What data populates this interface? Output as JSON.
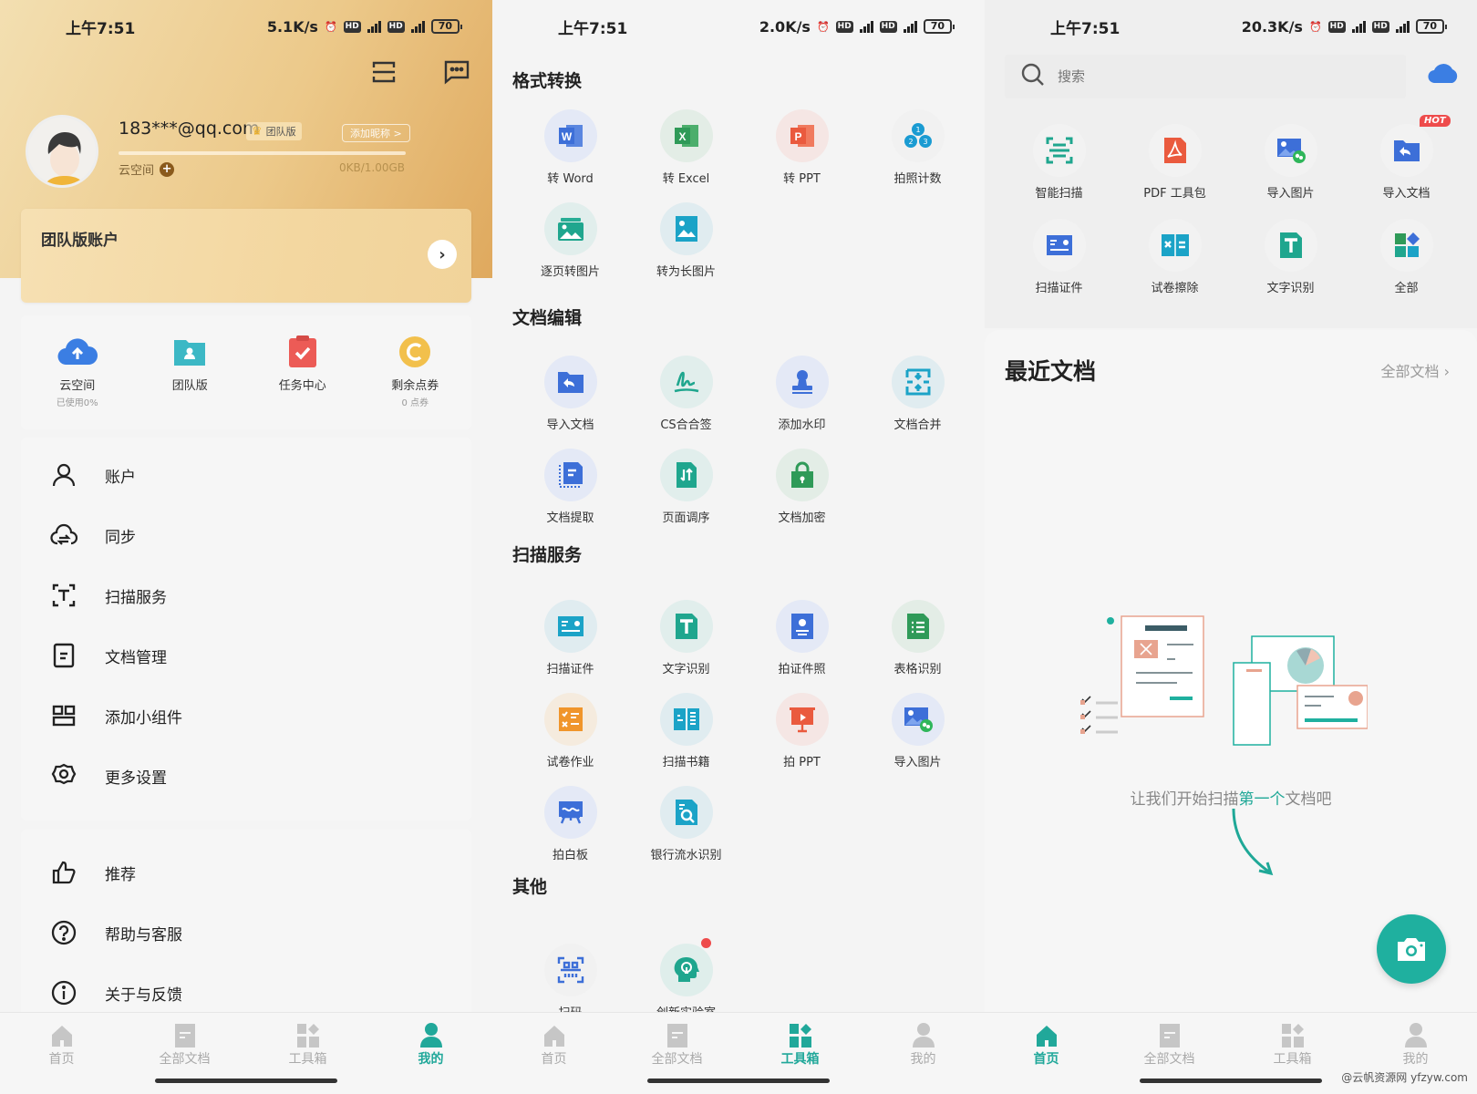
{
  "colors": {
    "accent": "#21a89a",
    "gold_start": "#f3dfb1",
    "gold_end": "#dfa95e",
    "badge_red": "#ee4b4b"
  },
  "status_bars": [
    {
      "time": "上午7:51",
      "speed": "5.1K/s",
      "battery": "70"
    },
    {
      "time": "上午7:51",
      "speed": "2.0K/s",
      "battery": "70"
    },
    {
      "time": "上午7:51",
      "speed": "20.3K/s",
      "battery": "70"
    }
  ],
  "profile": {
    "email": "183***@qq.com",
    "plan_badge": "团队版",
    "add_nickname": "添加昵称 >",
    "cloud_label": "云空间",
    "cloud_usage": "0KB/1.00GB",
    "cloud_used_fraction": 0.0,
    "team_card_title": "团队版账户",
    "icons": [
      "scan-icon",
      "message-icon"
    ]
  },
  "quick_actions": [
    {
      "label": "云空间",
      "sub": "已使用0%",
      "icon": "cloud-upload-icon"
    },
    {
      "label": "团队版",
      "sub": "",
      "icon": "team-folder-icon"
    },
    {
      "label": "任务中心",
      "sub": "",
      "icon": "task-check-icon"
    },
    {
      "label": "剩余点券",
      "sub": "0 点券",
      "icon": "coupon-coin-icon"
    }
  ],
  "menu_main": [
    {
      "label": "账户",
      "icon": "user-icon"
    },
    {
      "label": "同步",
      "icon": "cloud-sync-icon"
    },
    {
      "label": "扫描服务",
      "icon": "text-scan-icon"
    },
    {
      "label": "文档管理",
      "icon": "document-icon"
    },
    {
      "label": "添加小组件",
      "icon": "widget-icon"
    },
    {
      "label": "更多设置",
      "icon": "gear-icon"
    }
  ],
  "menu_secondary": [
    {
      "label": "推荐",
      "icon": "thumbs-up-icon"
    },
    {
      "label": "帮助与客服",
      "icon": "help-icon"
    },
    {
      "label": "关于与反馈",
      "icon": "info-icon"
    }
  ],
  "bottom_nav": [
    {
      "label": "首页",
      "icon": "home-icon"
    },
    {
      "label": "全部文档",
      "icon": "documents-icon"
    },
    {
      "label": "工具箱",
      "icon": "toolbox-icon"
    },
    {
      "label": "我的",
      "icon": "me-icon"
    }
  ],
  "toolbox": {
    "sections": [
      {
        "title": "格式转换",
        "items": [
          {
            "label": "转 Word",
            "icon": "word-icon"
          },
          {
            "label": "转 Excel",
            "icon": "excel-icon"
          },
          {
            "label": "转 PPT",
            "icon": "ppt-icon"
          },
          {
            "label": "拍照计数",
            "icon": "photo-count-icon"
          },
          {
            "label": "逐页转图片",
            "icon": "pages-to-image-icon"
          },
          {
            "label": "转为长图片",
            "icon": "long-image-icon"
          }
        ]
      },
      {
        "title": "文档编辑",
        "items": [
          {
            "label": "导入文档",
            "icon": "import-doc-icon"
          },
          {
            "label": "CS合合签",
            "icon": "signature-icon"
          },
          {
            "label": "添加水印",
            "icon": "watermark-stamp-icon"
          },
          {
            "label": "文档合并",
            "icon": "merge-icon"
          },
          {
            "label": "文档提取",
            "icon": "extract-icon"
          },
          {
            "label": "页面调序",
            "icon": "reorder-icon"
          },
          {
            "label": "文档加密",
            "icon": "lock-icon"
          }
        ]
      },
      {
        "title": "扫描服务",
        "items": [
          {
            "label": "扫描证件",
            "icon": "id-card-icon"
          },
          {
            "label": "文字识别",
            "icon": "ocr-text-icon"
          },
          {
            "label": "拍证件照",
            "icon": "id-photo-icon"
          },
          {
            "label": "表格识别",
            "icon": "table-ocr-icon"
          },
          {
            "label": "试卷作业",
            "icon": "exam-icon"
          },
          {
            "label": "扫描书籍",
            "icon": "book-scan-icon"
          },
          {
            "label": "拍 PPT",
            "icon": "presentation-icon"
          },
          {
            "label": "导入图片",
            "icon": "import-image-icon"
          },
          {
            "label": "拍白板",
            "icon": "whiteboard-icon"
          },
          {
            "label": "银行流水识别",
            "icon": "bank-statement-icon"
          }
        ]
      },
      {
        "title": "其他",
        "items": [
          {
            "label": "扫码",
            "icon": "qr-scan-icon"
          },
          {
            "label": "创新实验室",
            "icon": "innovation-lab-icon",
            "badge_dot": true
          }
        ]
      }
    ]
  },
  "home": {
    "search_placeholder": "搜索",
    "tools": [
      {
        "label": "智能扫描",
        "icon": "smart-scan-icon"
      },
      {
        "label": "PDF 工具包",
        "icon": "pdf-icon"
      },
      {
        "label": "导入图片",
        "icon": "import-image-icon"
      },
      {
        "label": "导入文档",
        "icon": "import-doc-icon",
        "badge": "HOT"
      },
      {
        "label": "扫描证件",
        "icon": "id-card-icon"
      },
      {
        "label": "试卷擦除",
        "icon": "exam-erase-icon"
      },
      {
        "label": "文字识别",
        "icon": "ocr-text-icon"
      },
      {
        "label": "全部",
        "icon": "all-tools-icon"
      }
    ],
    "recent_title": "最近文档",
    "all_docs_link": "全部文档",
    "empty_pre": "让我们开始扫描",
    "empty_highlight": "第一个",
    "empty_post": "文档吧",
    "watermark": "@云帆资源网 yfzyw.com"
  }
}
